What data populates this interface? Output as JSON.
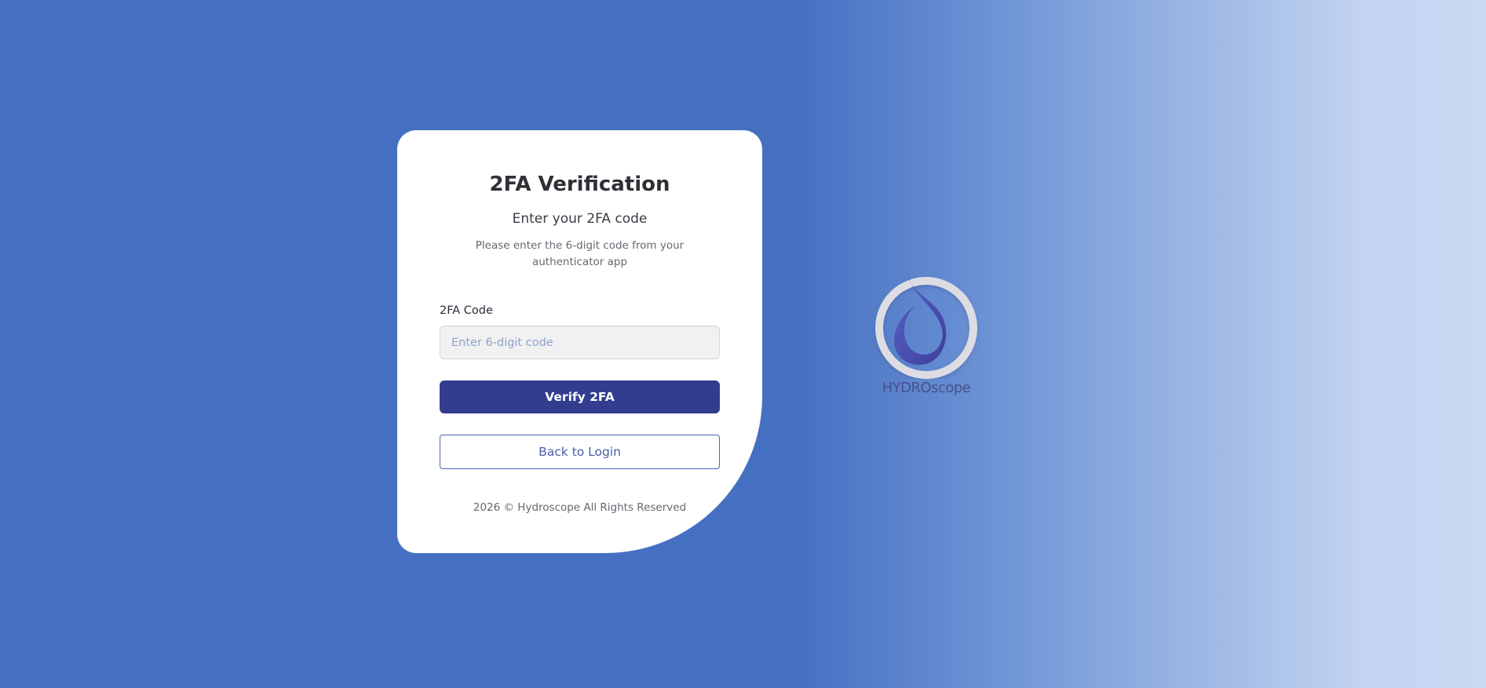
{
  "card": {
    "title": "2FA Verification",
    "subtitle": "Enter your 2FA code",
    "description": "Please enter the 6-digit code from your authenticator app",
    "field": {
      "label": "2FA Code",
      "value": "",
      "placeholder": "Enter 6-digit code"
    },
    "verify_label": "Verify 2FA",
    "back_label": "Back to Login",
    "footer": "2026 © Hydroscope All Rights Reserved"
  },
  "brand": {
    "logo_text": "HYDROscope",
    "logo_icon": "water-drop-ring-logo"
  },
  "colors": {
    "primary": "#323d90",
    "outline": "#4c63b6",
    "background_start": "#4570c2",
    "background_end": "#cad8f2"
  }
}
